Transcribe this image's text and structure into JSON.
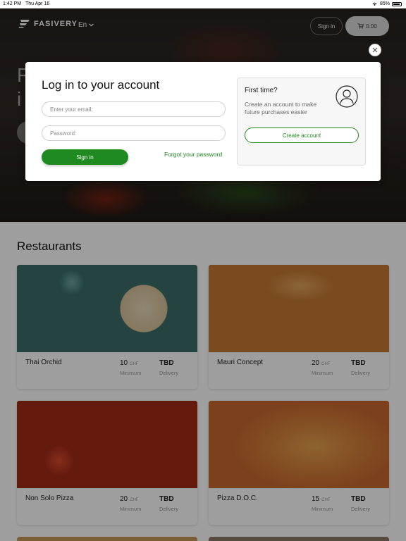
{
  "status_bar": {
    "time": "1:42 PM",
    "date": "Thu Apr 16",
    "battery": "85%"
  },
  "nav": {
    "logo": "FASIVERY",
    "language": "En",
    "signin": "Sign in",
    "cart_total": "0.00"
  },
  "hero": {
    "text_partial": "F\ni"
  },
  "modal": {
    "title": "Log in to your account",
    "email_placeholder": "Enter your email:",
    "password_placeholder": "Password:",
    "signin_label": "Sign in",
    "forgot_label": "Forgot your password",
    "first_time": {
      "title": "First time?",
      "description": "Create an account to make future purchases easier",
      "create_label": "Create account"
    }
  },
  "restaurants": {
    "title": "Restaurants",
    "items": [
      {
        "name": "Thai Orchid",
        "minimum": "10",
        "currency": "CHF",
        "minimum_label": "Minimum",
        "delivery": "TBD",
        "delivery_label": "Delivery"
      },
      {
        "name": "Mauri Concept",
        "minimum": "20",
        "currency": "CHF",
        "minimum_label": "Minimum",
        "delivery": "TBD",
        "delivery_label": "Delivery"
      },
      {
        "name": "Non Solo Pizza",
        "minimum": "20",
        "currency": "CHF",
        "minimum_label": "Minimum",
        "delivery": "TBD",
        "delivery_label": "Delivery"
      },
      {
        "name": "Pizza D.O.C.",
        "minimum": "15",
        "currency": "CHF",
        "minimum_label": "Minimum",
        "delivery": "TBD",
        "delivery_label": "Delivery"
      }
    ]
  },
  "colors": {
    "accent": "#1f8a1f"
  }
}
